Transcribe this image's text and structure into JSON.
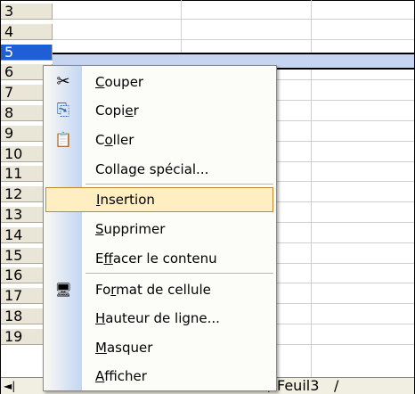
{
  "row_headers": [
    "3",
    "4",
    "5",
    "6",
    "7",
    "8",
    "9",
    "10",
    "11",
    "12",
    "13",
    "14",
    "15",
    "16",
    "17",
    "18",
    "19"
  ],
  "selected_row": "5",
  "sheet_tab": {
    "label": "Feuil3",
    "slash": "/"
  },
  "tab_nav": {
    "first_symbol": "◄|"
  },
  "context_menu": {
    "items": [
      {
        "icon": "scissors-icon",
        "glyph": "✂",
        "pre": "",
        "u": "C",
        "post": "ouper"
      },
      {
        "icon": "copy-icon",
        "glyph": "⎘",
        "pre": "Copi",
        "u": "e",
        "post": "r"
      },
      {
        "icon": "paste-icon",
        "glyph": "📋",
        "pre": "C",
        "u": "o",
        "post": "ller"
      },
      {
        "icon": "",
        "glyph": "",
        "pre": "Colla",
        "u": "g",
        "post": "e spécial..."
      },
      {
        "icon": "",
        "glyph": "",
        "pre": "",
        "u": "I",
        "post": "nsertion"
      },
      {
        "icon": "",
        "glyph": "",
        "pre": "",
        "u": "S",
        "post": "upprimer"
      },
      {
        "icon": "",
        "glyph": "",
        "pre": "E",
        "u": "f",
        "post": "facer le contenu"
      },
      {
        "icon": "format-cell-icon",
        "glyph": "🖥",
        "pre": "Fo",
        "u": "r",
        "post": "mat de cellule"
      },
      {
        "icon": "",
        "glyph": "",
        "pre": "",
        "u": "H",
        "post": "auteur de ligne..."
      },
      {
        "icon": "",
        "glyph": "",
        "pre": "",
        "u": "M",
        "post": "asquer"
      },
      {
        "icon": "",
        "glyph": "",
        "pre": "",
        "u": "A",
        "post": "fficher"
      }
    ]
  }
}
